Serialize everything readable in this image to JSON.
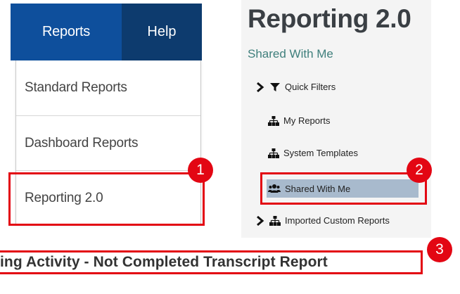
{
  "nav": {
    "reports": "Reports",
    "help": "Help"
  },
  "dropdown": {
    "items": [
      {
        "label": "Standard Reports"
      },
      {
        "label": "Dashboard Reports"
      },
      {
        "label": "Reporting 2.0"
      }
    ]
  },
  "panel": {
    "title": "Reporting 2.0",
    "subtitle": "Shared With Me",
    "tree": {
      "quick_filters": "Quick Filters",
      "my_reports": "My Reports",
      "system_templates": "System Templates",
      "shared_with_me": "Shared With Me",
      "imported_custom_reports": "Imported Custom Reports"
    }
  },
  "banner": {
    "text": "ing Activity - Not Completed Transcript Report"
  },
  "badges": {
    "one": "1",
    "two": "2",
    "three": "3"
  },
  "colors": {
    "highlight": "#e30613",
    "nav_reports": "#0e4f9c",
    "nav_help": "#0d3b6e",
    "selected_row": "#a8bacd"
  }
}
